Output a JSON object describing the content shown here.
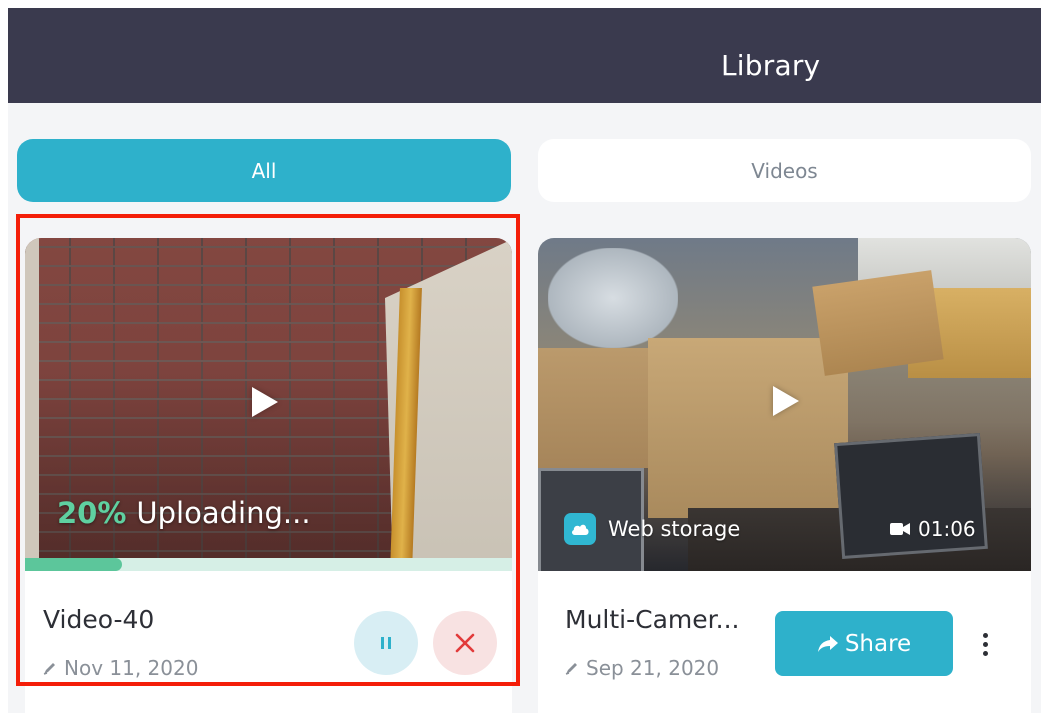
{
  "header": {
    "title": "Library"
  },
  "tabs": [
    {
      "label": "All",
      "selected": true
    },
    {
      "label": "Videos",
      "selected": false
    }
  ],
  "cards": [
    {
      "title": "Video-40",
      "date": "Nov 11, 2020",
      "upload": {
        "percent_label": "20%",
        "status_label": "Uploading...",
        "progress": 0.2
      },
      "actions": {
        "pause_icon": "pause-icon",
        "cancel_icon": "close-icon"
      },
      "highlighted": true
    },
    {
      "title": "Multi-Camer...",
      "date": "Sep 21, 2020",
      "storage_label": "Web storage",
      "duration": "01:06",
      "share_label": "Share",
      "more_icon": "more-vertical-icon"
    }
  ],
  "colors": {
    "header_bg": "#3a3a4e",
    "accent": "#2eb1cb",
    "progress": "#5cc69b",
    "upload_percent": "#5fd0a0",
    "cancel": "#e23b3b",
    "highlight": "#f41e09"
  }
}
